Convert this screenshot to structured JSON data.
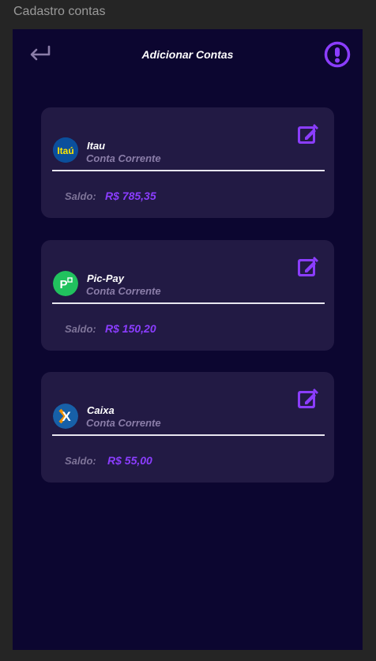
{
  "window": {
    "title": "Cadastro contas"
  },
  "header": {
    "title": "Adicionar Contas"
  },
  "accounts": [
    {
      "name": "Itau",
      "type": "Conta Corrente",
      "saldo_label": "Saldo:",
      "saldo": "R$ 785,35",
      "logo_text": "Itaú"
    },
    {
      "name": "Pic-Pay",
      "type": "Conta Corrente",
      "saldo_label": "Saldo:",
      "saldo": "R$ 150,20",
      "logo_text": "P"
    },
    {
      "name": "Caixa",
      "type": "Conta Corrente",
      "saldo_label": "Saldo:",
      "saldo": "R$ 55,00",
      "logo_text": "X"
    }
  ],
  "colors": {
    "background": "#0c0630",
    "card": "#221a44",
    "accent": "#8b3dff",
    "itau": "#0b4f9c",
    "picpay": "#21c25e",
    "caixa": "#1760a8"
  },
  "icons": {
    "back": "return-arrow-icon",
    "alert": "exclamation-circle-icon",
    "edit": "edit-square-icon"
  }
}
